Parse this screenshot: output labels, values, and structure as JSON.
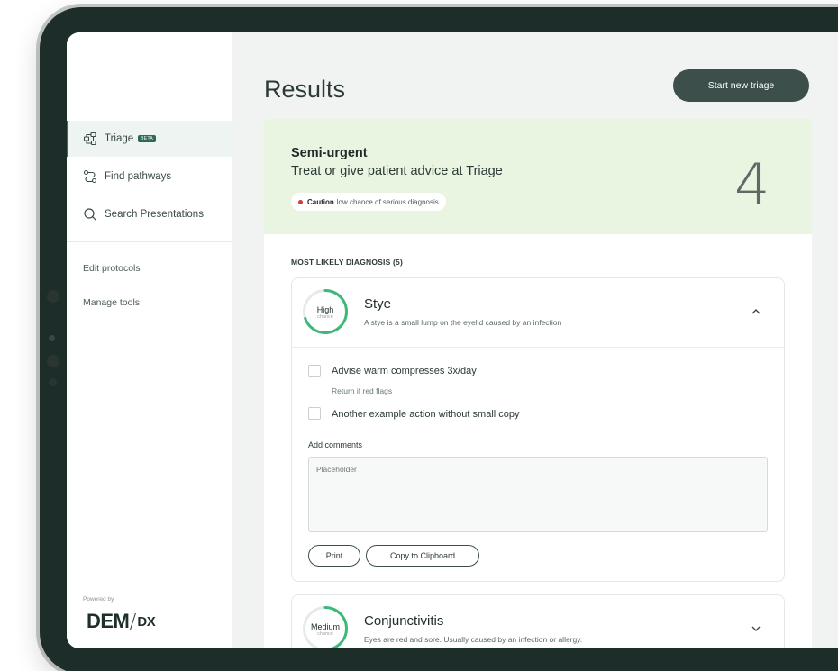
{
  "sidebar": {
    "nav": [
      {
        "label": "Triage",
        "icon": "triage-icon",
        "badge": "BETA",
        "active": true
      },
      {
        "label": "Find pathways",
        "icon": "pathways-icon"
      },
      {
        "label": "Search Presentations",
        "icon": "search-icon"
      }
    ],
    "tools": [
      "Edit protocols",
      "Manage tools"
    ],
    "powered_by": "Powered by",
    "logo_main": "DEM",
    "logo_sub": "DX"
  },
  "header": {
    "title": "Results",
    "start_button": "Start new triage"
  },
  "urgency": {
    "title": "Semi-urgent",
    "subtitle": "Treat or give patient advice at Triage",
    "caution_label": "Caution",
    "caution_text": "low chance of serious diagnosis",
    "level": "4",
    "background_color": "#e9f5e1"
  },
  "diagnoses": {
    "header": "MOST LIKELY DIAGNOSIS (5)",
    "items": [
      {
        "chance_level": "High",
        "chance_word": "chance",
        "chance_fraction": 0.7,
        "name": "Stye",
        "description": "A stye is a small lump on the eyelid caused by an infection",
        "expanded": true,
        "actions": [
          {
            "label": "Advise warm compresses 3x/day",
            "small": "Return if red flags"
          },
          {
            "label": "Another example action without small copy"
          }
        ],
        "comments_label": "Add comments",
        "comments_placeholder": "Placeholder",
        "print_label": "Print",
        "copy_label": "Copy to Clipboard"
      },
      {
        "chance_level": "Medium",
        "chance_word": "chance",
        "chance_fraction": 0.45,
        "name": "Conjunctivitis",
        "description": "Eyes are red and sore. Usually caused by an infection or allergy.",
        "expanded": false
      }
    ]
  },
  "colors": {
    "accent": "#3b6e5e",
    "button": "#3c4f4a",
    "chance_ring": "#3cb878",
    "caution_dot": "#d63a3a"
  }
}
